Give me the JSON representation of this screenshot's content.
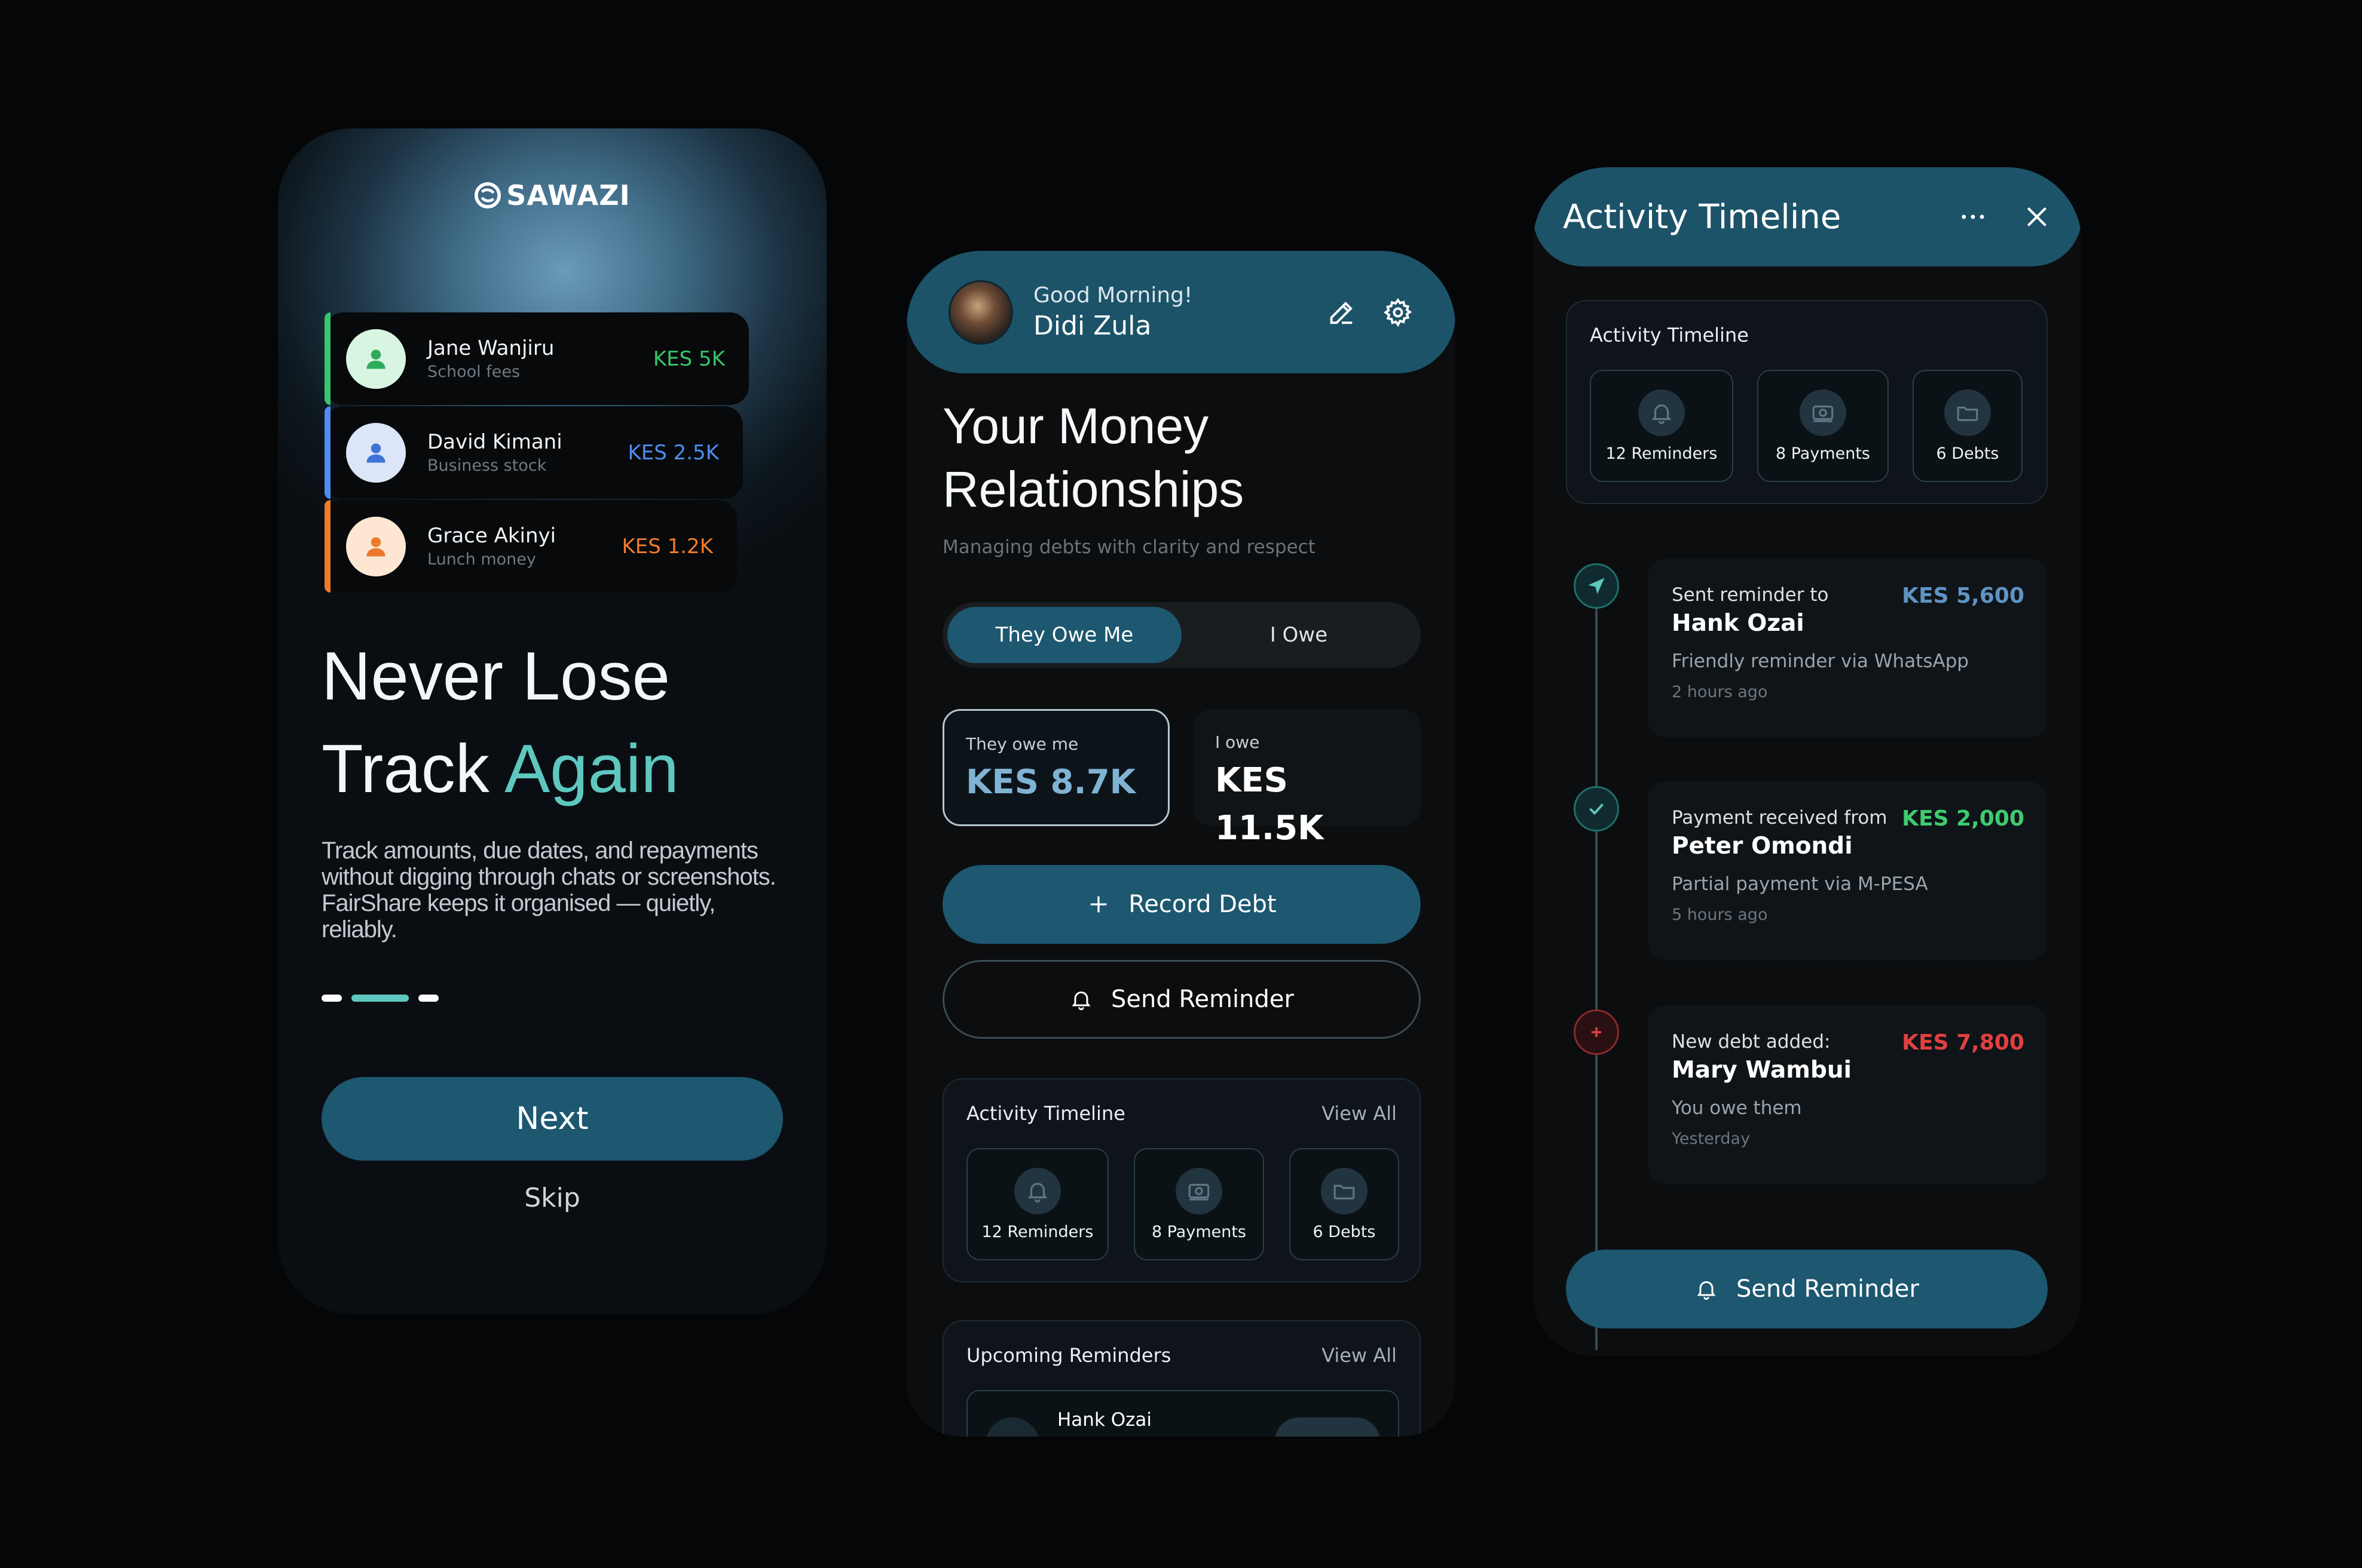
{
  "onboarding": {
    "logo": "SAWAZI",
    "debts": [
      {
        "name": "Jane Wanjiru",
        "note": "School fees",
        "amount": "KES 5K",
        "color": "#39c66b",
        "avatar_bg": "#d8f5e1",
        "avatar_fg": "#2faa5b"
      },
      {
        "name": "David Kimani",
        "note": "Business stock",
        "amount": "KES 2.5K",
        "color": "#4f8df0",
        "avatar_bg": "#dce6f8",
        "avatar_fg": "#3f74d6"
      },
      {
        "name": "Grace Akinyi",
        "note": "Lunch money",
        "amount": "KES 1.2K",
        "color": "#f07a2a",
        "avatar_bg": "#fde7d3",
        "avatar_fg": "#ec7a2a"
      }
    ],
    "headline_line1": "Never Lose",
    "headline_line2a": "Track",
    "headline_line2b": "Again",
    "description": "Track amounts, due dates, and repayments without digging through chats or screenshots. FairShare keeps it organised — quietly, reliably.",
    "next_label": "Next",
    "skip_label": "Skip",
    "accent": "#5ec8c0"
  },
  "home": {
    "greeting": "Good Morning!",
    "user_name": "Didi Zula",
    "title_line1": "Your Money",
    "title_line2": "Relationships",
    "subtitle": "Managing debts with clarity and respect",
    "tabs": [
      {
        "label": "They Owe Me",
        "active": true
      },
      {
        "label": "I Owe",
        "active": false
      }
    ],
    "summary": [
      {
        "label": "They owe me",
        "value": "KES 8.7K"
      },
      {
        "label": "I owe",
        "value": "KES 11.5K"
      }
    ],
    "record_label": "Record Debt",
    "send_reminder_label": "Send Reminder",
    "activity": {
      "title": "Activity Timeline",
      "view_all": "View All",
      "tiles": [
        {
          "label": "12 Reminders"
        },
        {
          "label": "8 Payments"
        },
        {
          "label": "6 Debts"
        }
      ]
    },
    "upcoming": {
      "title": "Upcoming Reminders",
      "view_all": "View All",
      "first_name": "Hank Ozai"
    },
    "primary": "#1d5770"
  },
  "timeline": {
    "title": "Activity Timeline",
    "summary_title": "Activity Timeline",
    "tiles": [
      {
        "label": "12 Reminders"
      },
      {
        "label": "8 Payments"
      },
      {
        "label": "6 Debts"
      }
    ],
    "events": [
      {
        "action": "Sent reminder to",
        "name": "Hank Ozai",
        "detail": "Friendly reminder via WhatsApp",
        "time": "2 hours ago",
        "amount": "KES 5,600",
        "color": "#5f93c2",
        "type": "reminder"
      },
      {
        "action": "Payment received from",
        "name": "Peter Omondi",
        "detail": "Partial payment via M-PESA",
        "time": "5 hours ago",
        "amount": "KES 2,000",
        "color": "#3fcb6e",
        "type": "payment"
      },
      {
        "action": "New debt added:",
        "name": "Mary Wambui",
        "detail": "You owe them",
        "time": "Yesterday",
        "amount": "KES 7,800",
        "color": "#e2403f",
        "type": "debt"
      }
    ],
    "send_reminder_label": "Send Reminder"
  }
}
